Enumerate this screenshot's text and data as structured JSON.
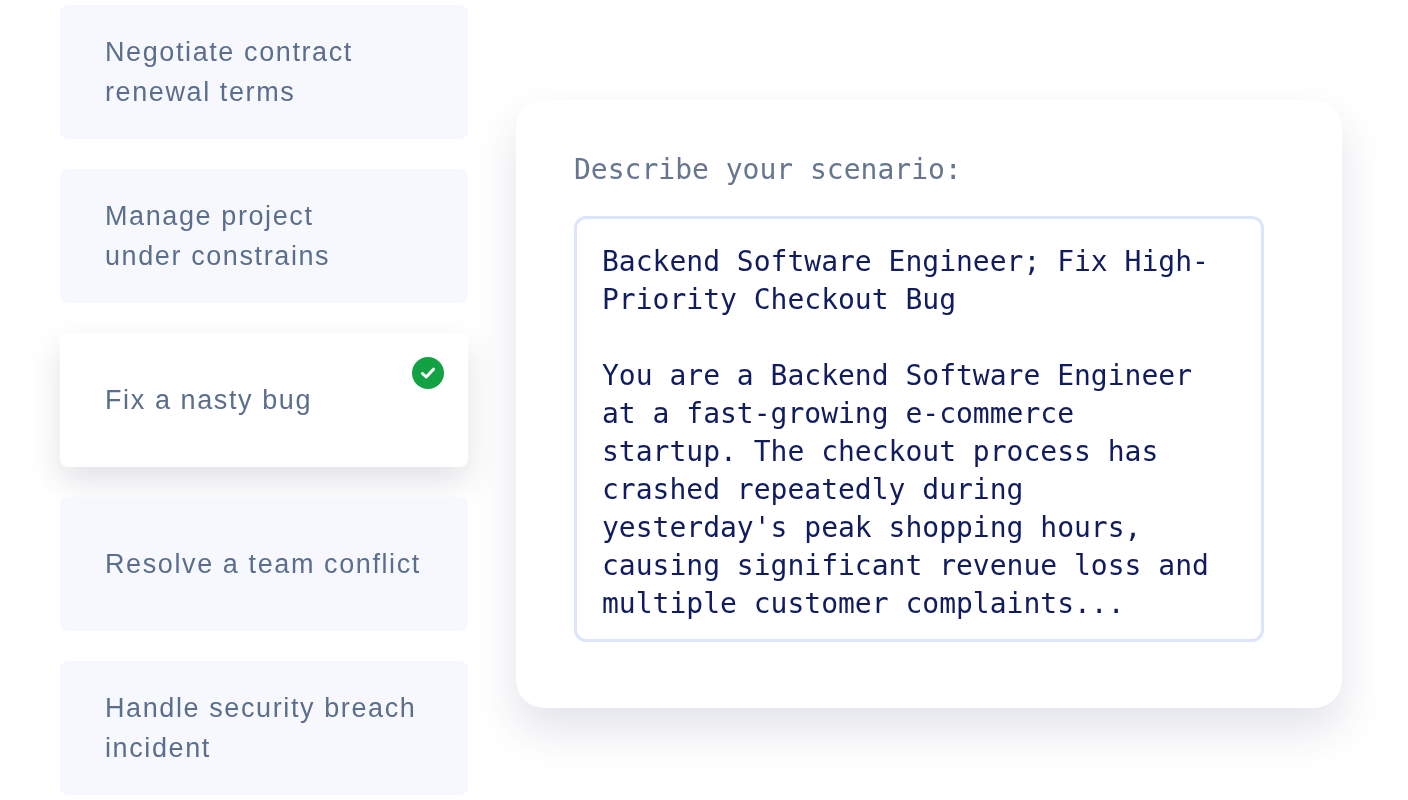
{
  "scenarios": [
    {
      "label": "Negotiate contract\nrenewal terms",
      "selected": false
    },
    {
      "label": "Manage project\nunder constrains",
      "selected": false
    },
    {
      "label": "Fix a nasty bug",
      "selected": true
    },
    {
      "label": "Resolve a team conflict",
      "selected": false
    },
    {
      "label": "Handle security breach\nincident",
      "selected": false
    }
  ],
  "scenario_form": {
    "label": "Describe your scenario:",
    "value": "Backend Software Engineer; Fix High-Priority Checkout Bug\n\nYou are a Backend Software Engineer at a fast-growing e-commerce startup. The checkout process has crashed repeatedly during yesterday's peak shopping hours, causing significant revenue loss and multiple customer complaints..."
  }
}
